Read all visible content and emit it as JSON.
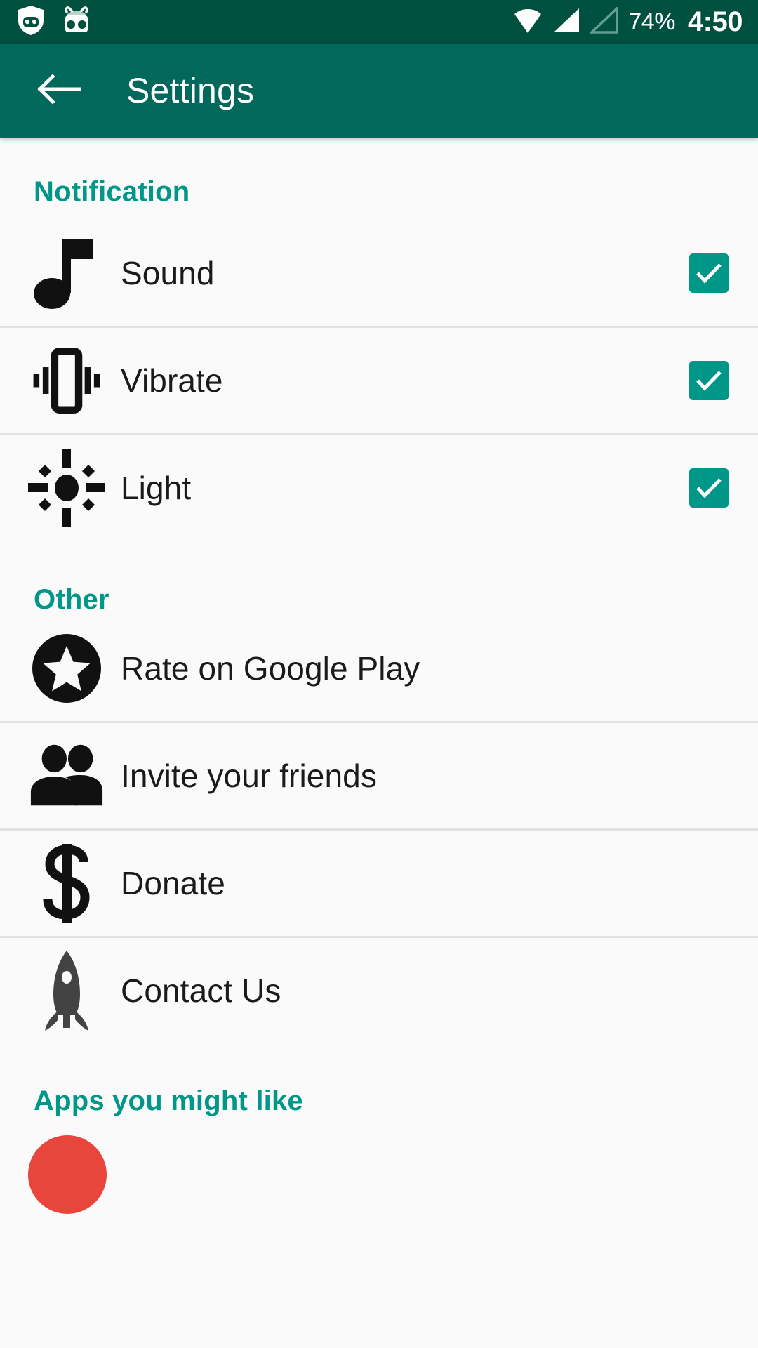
{
  "status_bar": {
    "background": "#00503f",
    "left_icons": [
      {
        "name": "privacy-guard-shield-icon",
        "label": "Privacy Guard"
      },
      {
        "name": "cyanogenmod-cid-icon",
        "label": "CyanogenMod"
      }
    ],
    "right_icons": [
      {
        "name": "wifi-icon",
        "label": "Wi-Fi"
      },
      {
        "name": "signal-full-icon",
        "label": "Signal bar 1"
      },
      {
        "name": "signal-empty-icon",
        "label": "Signal bar 2"
      }
    ],
    "battery": "74%",
    "clock": "4:50"
  },
  "app_bar": {
    "background": "#00695c",
    "back_icon": "back-arrow-icon",
    "title": "Settings"
  },
  "accent_color": "#009688",
  "sections": [
    {
      "id": "notification",
      "header": "Notification",
      "rows": [
        {
          "id": "sound",
          "icon": "music-note-icon",
          "label": "Sound",
          "control": "checkbox",
          "checked": true
        },
        {
          "id": "vibrate",
          "icon": "vibration-icon",
          "label": "Vibrate",
          "control": "checkbox",
          "checked": true
        },
        {
          "id": "light",
          "icon": "brightness-sun-icon",
          "label": "Light",
          "control": "checkbox",
          "checked": true
        }
      ]
    },
    {
      "id": "other",
      "header": "Other",
      "rows": [
        {
          "id": "rate",
          "icon": "star-circle-icon",
          "label": "Rate on Google Play",
          "control": "none"
        },
        {
          "id": "invite",
          "icon": "people-icon",
          "label": "Invite your friends",
          "control": "none"
        },
        {
          "id": "donate",
          "icon": "dollar-sign-icon",
          "label": "Donate",
          "control": "none"
        },
        {
          "id": "contact",
          "icon": "rocket-icon",
          "label": "Contact Us",
          "control": "none"
        }
      ]
    },
    {
      "id": "apps",
      "header": "Apps you might like",
      "rows": []
    }
  ]
}
